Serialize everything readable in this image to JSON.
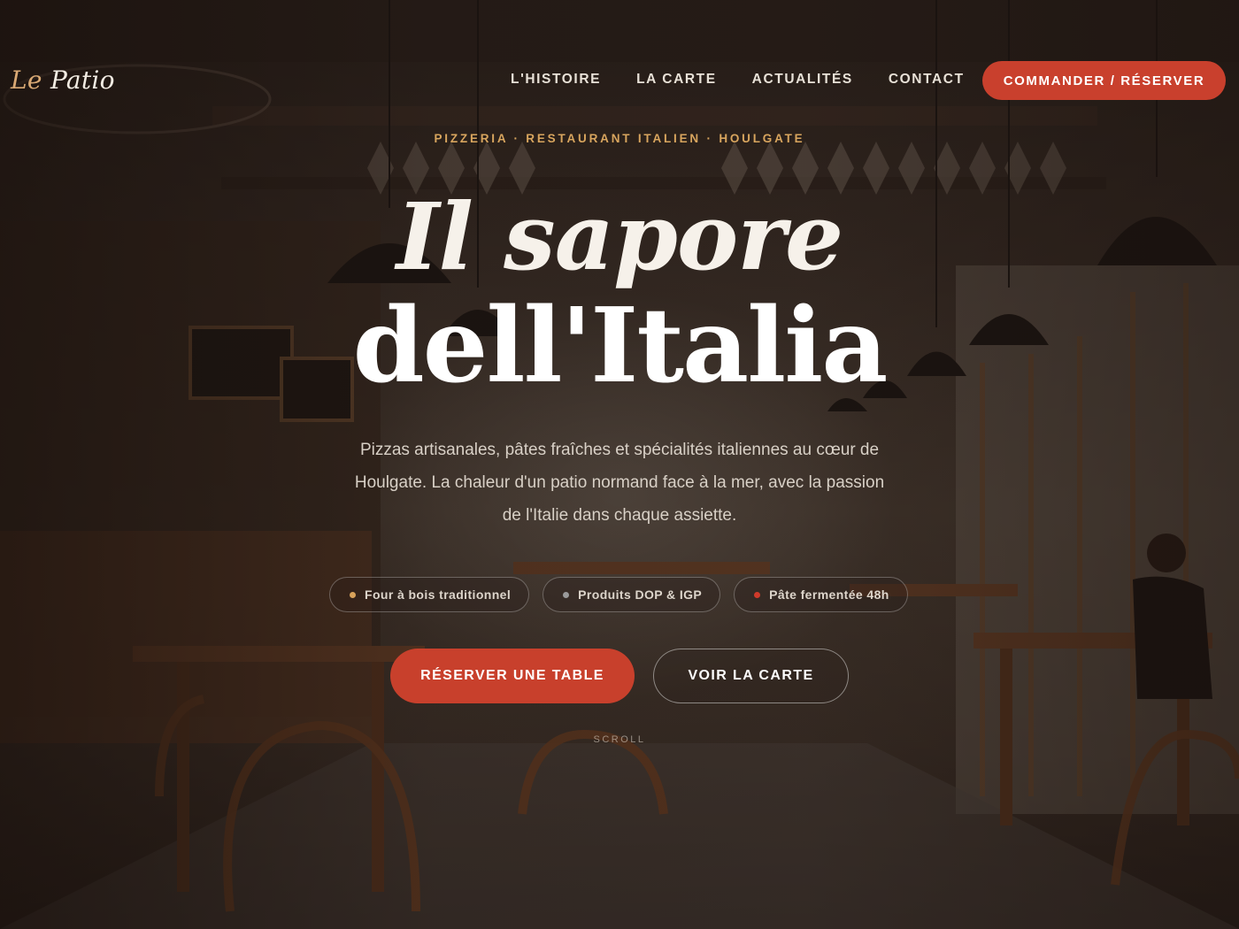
{
  "nav": {
    "logo_le": "Le",
    "logo_patio": "Patio",
    "links": [
      "L'HISTOIRE",
      "LA CARTE",
      "ACTUALITÉS",
      "CONTACT"
    ],
    "cta": "COMMANDER / RÉSERVER"
  },
  "hero": {
    "kicker": "PIZZERIA · RESTAURANT ITALIEN · HOULGATE",
    "title_line1": "Il sapore",
    "title_line2": "dell'Italia",
    "subtitle": "Pizzas artisanales, pâtes fraîches et spécialités italiennes au cœur de Houlgate. La chaleur d'un patio normand face à la mer, avec la passion de l'Italie dans chaque assiette.",
    "features": [
      {
        "label": "Four à bois traditionnel",
        "dot_color": "#d9a25a"
      },
      {
        "label": "Produits DOP & IGP",
        "dot_color": "#9a9a9a"
      },
      {
        "label": "Pâte fermentée 48h",
        "dot_color": "#d03a2a"
      }
    ],
    "primary_button": "RÉSERVER UNE TABLE",
    "secondary_button": "VOIR LA CARTE",
    "scroll": "SCROLL"
  },
  "colors": {
    "accent": "#c8402c",
    "kicker": "#d8a55e"
  }
}
